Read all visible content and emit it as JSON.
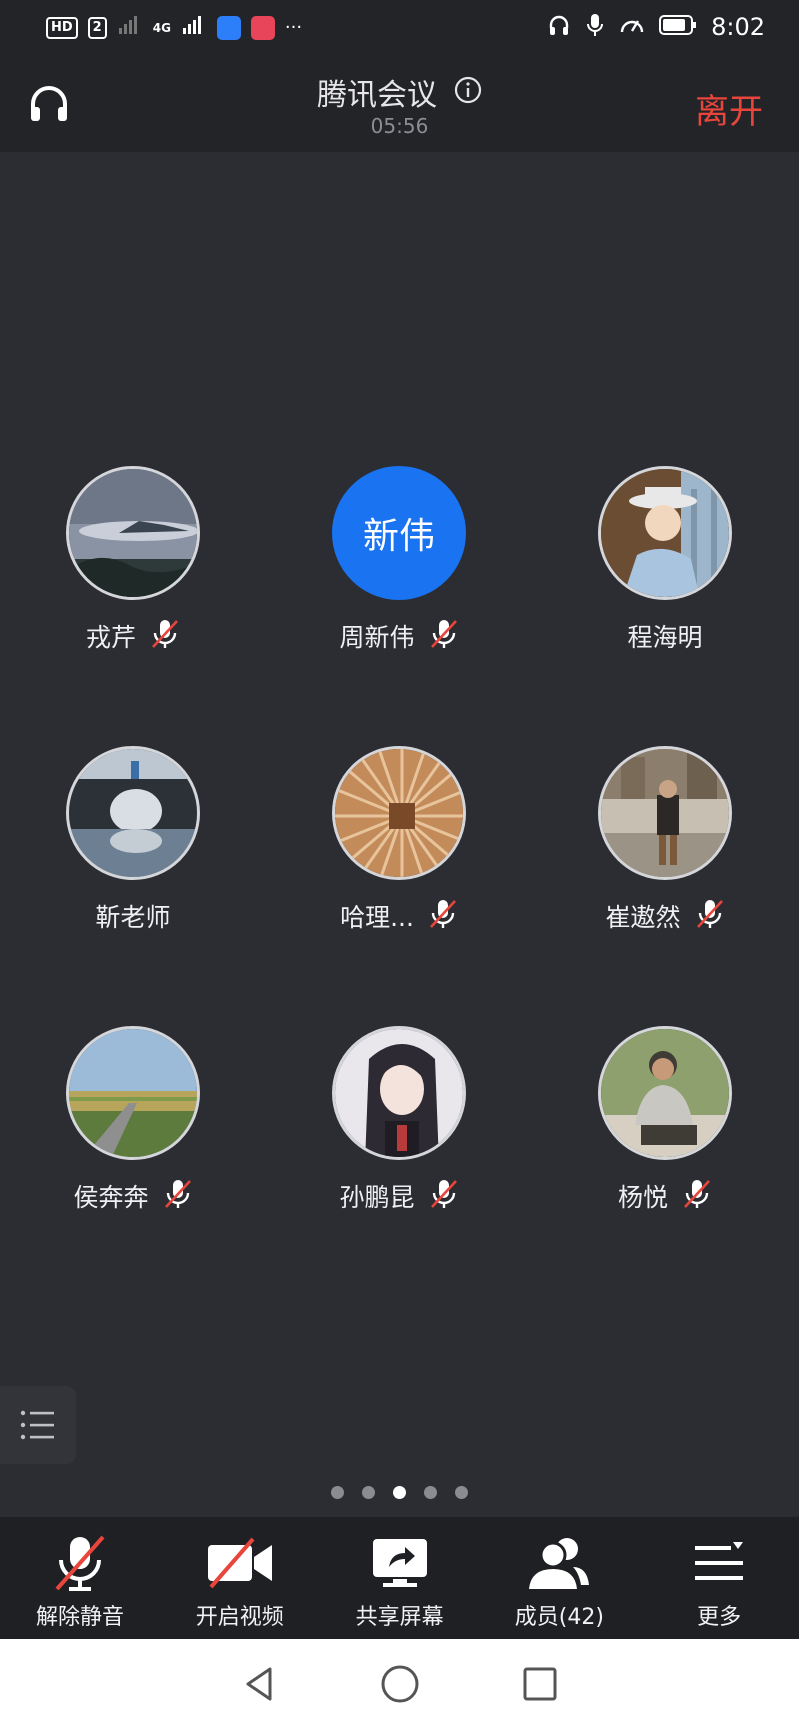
{
  "status_bar": {
    "hd_badge": "HD",
    "sim_badge": "2",
    "network": "4G",
    "time": "8:02",
    "more": "···"
  },
  "header": {
    "title": "腾讯会议",
    "timer": "05:56",
    "leave_label": "离开"
  },
  "participants": [
    {
      "name": "戎芹",
      "muted": true,
      "avatar": "photo-landscape-clouds",
      "colors": [
        "#8a93a3",
        "#c9ced8",
        "#2e3a3a"
      ]
    },
    {
      "name": "周新伟",
      "muted": true,
      "avatar_text": "新伟",
      "avatar_color": "#1a73f0"
    },
    {
      "name": "程海明",
      "muted": false,
      "avatar": "photo-anime-man-hat",
      "colors": [
        "#6b4d33",
        "#9db6cc",
        "#e8e8e8"
      ]
    },
    {
      "name": "靳老师",
      "muted": false,
      "avatar": "photo-stone-bridge",
      "colors": [
        "#bcc7d1",
        "#2b3137",
        "#6d7f93"
      ]
    },
    {
      "name": "哈理...",
      "muted": true,
      "avatar": "photo-wooden-lattice",
      "colors": [
        "#c48b5a",
        "#e8c49c",
        "#7a4a28"
      ]
    },
    {
      "name": "崔遨然",
      "muted": true,
      "avatar": "photo-plaza-person",
      "colors": [
        "#8c7e6c",
        "#c6bfb2",
        "#3a3632"
      ]
    },
    {
      "name": "侯奔奔",
      "muted": true,
      "avatar": "photo-field-road",
      "colors": [
        "#9cbbd9",
        "#b7a55b",
        "#5d7b3c"
      ]
    },
    {
      "name": "孙鹏昆",
      "muted": true,
      "avatar": "photo-anime-character",
      "colors": [
        "#e9e6ec",
        "#2d2a33",
        "#b83a3a"
      ]
    },
    {
      "name": "杨悦",
      "muted": true,
      "avatar": "photo-man-sitting",
      "colors": [
        "#8ea06e",
        "#d7d0c2",
        "#3f3b35"
      ]
    }
  ],
  "pagination": {
    "count": 5,
    "active": 2
  },
  "toolbar": {
    "items": [
      {
        "label": "解除静音",
        "icon": "mic-off-icon"
      },
      {
        "label": "开启视频",
        "icon": "video-off-icon"
      },
      {
        "label": "共享屏幕",
        "icon": "share-screen-icon"
      },
      {
        "label": "成员(42)",
        "icon": "members-icon"
      },
      {
        "label": "更多",
        "icon": "more-menu-icon"
      }
    ]
  },
  "colors": {
    "background": "#2b2d33",
    "header_bg": "#232428",
    "toolbar_bg": "#1f2024",
    "leave": "#e8453c",
    "avatar_blue": "#1a73f0",
    "mute_red": "#e8453c"
  }
}
